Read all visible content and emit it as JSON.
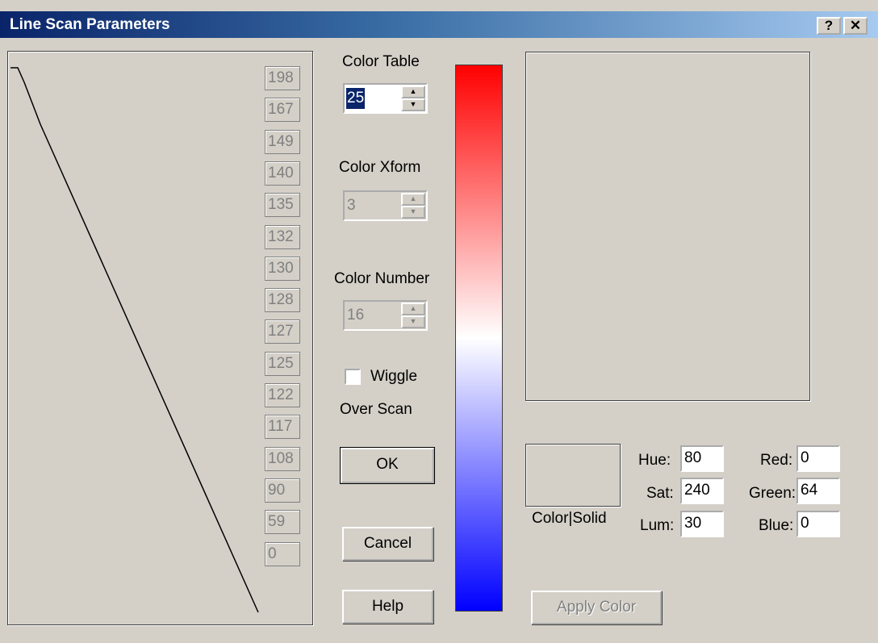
{
  "window": {
    "title": "Line Scan Parameters",
    "help_button": "?",
    "close_button": "✕"
  },
  "scan_values": [
    "198",
    "167",
    "149",
    "140",
    "135",
    "132",
    "130",
    "128",
    "127",
    "125",
    "122",
    "117",
    "108",
    "90",
    "59",
    "0"
  ],
  "color_table": {
    "label": "Color Table",
    "value": "25"
  },
  "color_xform": {
    "label": "Color  Xform",
    "value": "3"
  },
  "color_number": {
    "label": "Color Number",
    "value": "16"
  },
  "wiggle": {
    "label": "Wiggle",
    "checked": false
  },
  "over_scan_label": "Over Scan",
  "buttons": {
    "ok": "OK",
    "cancel": "Cancel",
    "help": "Help",
    "apply_color": "Apply Color"
  },
  "color_solid_label": "Color|Solid",
  "hsl": {
    "hue_label": "Hue:",
    "hue": "80",
    "sat_label": "Sat:",
    "sat": "240",
    "lum_label": "Lum:",
    "lum": "30"
  },
  "rgb": {
    "red_label": "Red:",
    "red": "0",
    "green_label": "Green:",
    "green": "64",
    "blue_label": "Blue:",
    "blue": "0"
  },
  "colors": {
    "gradient_top": "#ff0000",
    "gradient_mid": "#ffffff",
    "gradient_bottom": "#0000ff"
  }
}
